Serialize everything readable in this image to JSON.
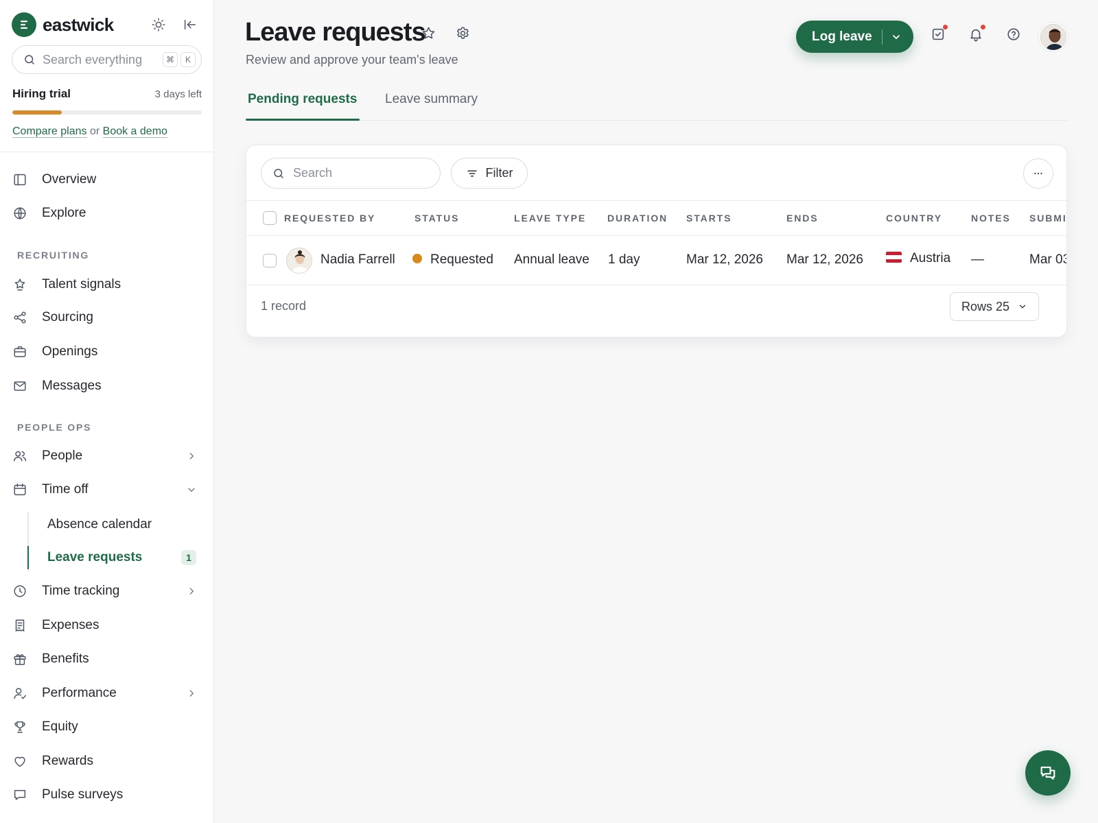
{
  "brand": {
    "name": "eastwick",
    "accent": "#1f6b48"
  },
  "sidebar": {
    "search": {
      "placeholder": "Search everything",
      "shortcut": [
        "⌘",
        "K"
      ]
    },
    "trial": {
      "title": "Hiring trial",
      "remaining": "3 days left",
      "progress_fraction": 0.26,
      "link_compare": "Compare plans",
      "connector": "or",
      "link_demo": "Book a demo"
    },
    "items": {
      "overview": "Overview",
      "explore": "Explore",
      "section_recruiting": "RECRUITING",
      "talent_signals": "Talent signals",
      "sourcing": "Sourcing",
      "openings": "Openings",
      "messages": "Messages",
      "section_people_ops": "PEOPLE OPS",
      "people": "People",
      "time_off": "Time off",
      "absence_calendar": "Absence calendar",
      "leave_requests": "Leave requests",
      "leave_requests_count": "1",
      "time_tracking": "Time tracking",
      "expenses": "Expenses",
      "benefits": "Benefits",
      "performance": "Performance",
      "equity": "Equity",
      "rewards": "Rewards",
      "pulse_surveys": "Pulse surveys"
    }
  },
  "header": {
    "title": "Leave requests",
    "subtitle": "Review and approve your team's leave",
    "primary_button": "Log leave"
  },
  "tabs": {
    "pending": "Pending requests",
    "summary": "Leave summary"
  },
  "table": {
    "search_placeholder": "Search",
    "filter_label": "Filter",
    "columns": {
      "requested_by": "REQUESTED BY",
      "status": "STATUS",
      "leave_type": "LEAVE TYPE",
      "duration": "DURATION",
      "starts": "STARTS",
      "ends": "ENDS",
      "country": "COUNTRY",
      "notes": "NOTES",
      "submitted": "SUBMI"
    },
    "rows": [
      {
        "name": "Nadia Farrell",
        "status": "Requested",
        "status_color": "#d98a1b",
        "leave_type": "Annual leave",
        "duration": "1 day",
        "starts": "Mar 12, 2026",
        "ends": "Mar 12, 2026",
        "country": "Austria",
        "notes": "—",
        "submitted": "Mar 03"
      }
    ],
    "record_count": "1 record",
    "rows_per_page": "Rows 25"
  }
}
